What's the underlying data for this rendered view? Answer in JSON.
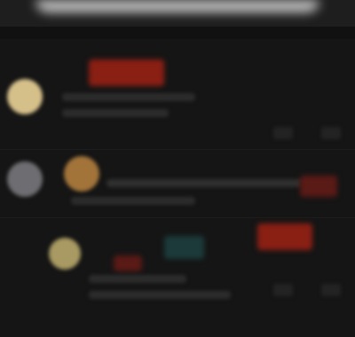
{
  "colors": {
    "background": "#151515",
    "top_bar": "#1e1e1e",
    "accent_red": "#8a1f14",
    "avatar_gold": "#d6c08a",
    "avatar_grey": "#6e6e72",
    "accent_teal": "#1c3a3a"
  },
  "comments": [
    {
      "author": "",
      "badge": "",
      "text": ""
    },
    {
      "author": "",
      "badge": "",
      "text": ""
    },
    {
      "author": "",
      "badge": "",
      "text": ""
    }
  ]
}
